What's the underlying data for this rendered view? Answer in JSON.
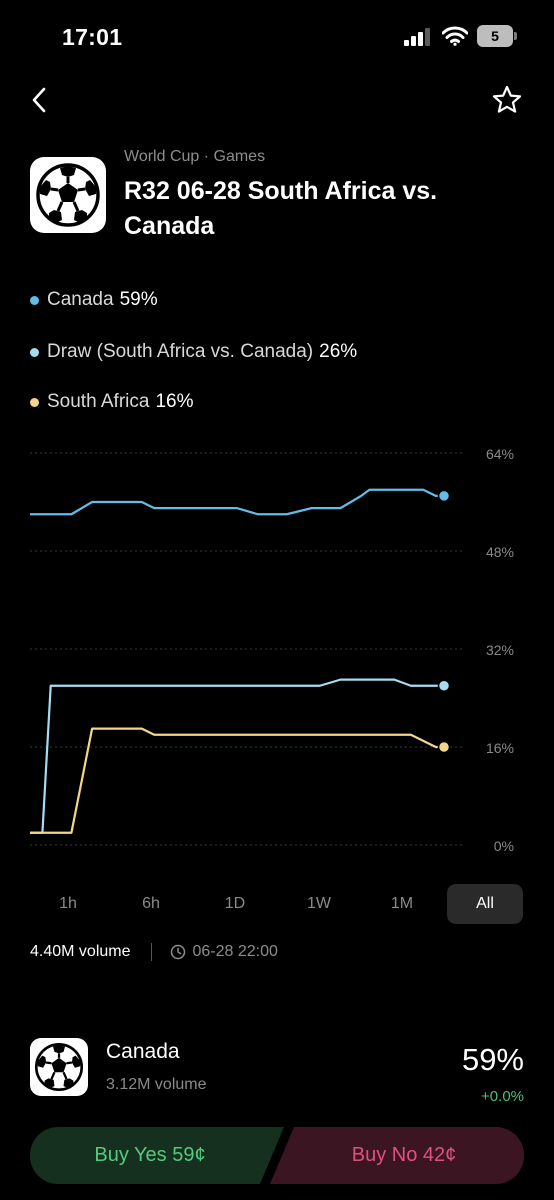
{
  "status_bar": {
    "time": "17:01",
    "battery": "5",
    "icons": [
      "signal-icon",
      "wifi-icon",
      "battery-icon"
    ]
  },
  "nav": {
    "back_icon": "chevron-left-icon",
    "favorite_icon": "star-outline-icon"
  },
  "header": {
    "breadcrumb": "World Cup · Games",
    "title": "R32 06-28 South Africa vs. Canada",
    "logo_icon": "soccer-ball-icon"
  },
  "legend": [
    {
      "name": "Canada",
      "pct": "59%",
      "color": "#62bde8"
    },
    {
      "name": "Draw (South Africa vs. Canada)",
      "pct": "26%",
      "color": "#a6dcf3"
    },
    {
      "name": "South Africa",
      "pct": "16%",
      "color": "#f4d68b"
    }
  ],
  "chart_data": {
    "type": "line",
    "y_ticks": [
      "64%",
      "48%",
      "32%",
      "16%",
      "0%"
    ],
    "ylim": [
      0,
      64
    ],
    "x": [
      0,
      3,
      5,
      10,
      15,
      20,
      23,
      27,
      30,
      34,
      35,
      40,
      45,
      50,
      55,
      58,
      62,
      68,
      70,
      75,
      80,
      82,
      85,
      88,
      92,
      95,
      98,
      100
    ],
    "series": [
      {
        "color": "#62bde8",
        "values": [
          54,
          54,
          54,
          54,
          56,
          56,
          56,
          56,
          55,
          55,
          55,
          55,
          55,
          55,
          54,
          54,
          54,
          55,
          55,
          55,
          57,
          58,
          58,
          58,
          58,
          58,
          57,
          57
        ]
      },
      {
        "color": "#a6dcf3",
        "values": [
          2,
          2,
          26,
          26,
          26,
          26,
          26,
          26,
          26,
          26,
          26,
          26,
          26,
          26,
          26,
          26,
          26,
          26,
          26,
          27,
          27,
          27,
          27,
          27,
          26,
          26,
          26,
          26
        ]
      },
      {
        "color": "#f4d68b",
        "values": [
          2,
          2,
          2,
          2,
          19,
          19,
          19,
          19,
          18,
          18,
          18,
          18,
          18,
          18,
          18,
          18,
          18,
          18,
          18,
          18,
          18,
          18,
          18,
          18,
          18,
          17,
          16,
          16
        ]
      }
    ]
  },
  "range_tabs": [
    "1h",
    "6h",
    "1D",
    "1W",
    "1M",
    "All"
  ],
  "active_range": "All",
  "meta": {
    "volume": "4.40M volume",
    "end_date": "06-28 22:00"
  },
  "outcome": {
    "name": "Canada",
    "volume": "3.12M volume",
    "pct": "59%",
    "change": "+0.0%"
  },
  "buttons": {
    "buy_yes": "Buy Yes 59¢",
    "buy_no": "Buy No 42¢"
  }
}
